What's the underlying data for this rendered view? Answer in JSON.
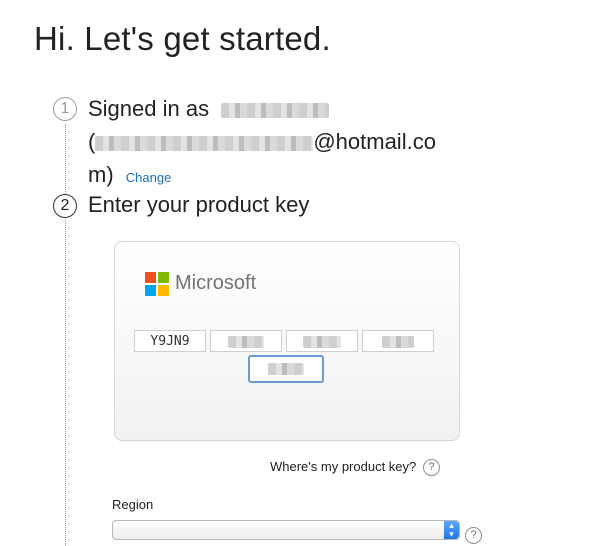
{
  "header": {
    "title": "Hi. Let's get started."
  },
  "steps": [
    {
      "number": "1",
      "label": "Signed in as",
      "email_suffix": "@hotmail.co",
      "email_wrap": "m)",
      "change_label": "Change"
    },
    {
      "number": "2",
      "label": "Enter your product key"
    }
  ],
  "card": {
    "brand": "Microsoft",
    "logo_colors": [
      "#f25022",
      "#7fba00",
      "#00a4ef",
      "#ffb900"
    ],
    "key_segments": [
      "Y9JN9",
      "",
      "",
      "",
      ""
    ]
  },
  "where_label": "Where's my product key?",
  "help_glyph": "?",
  "region": {
    "label": "Region",
    "value": ""
  },
  "colors": {
    "link": "#1f6fb5",
    "focus": "#6d9ad3",
    "select_arrow": "#1f74e6"
  }
}
